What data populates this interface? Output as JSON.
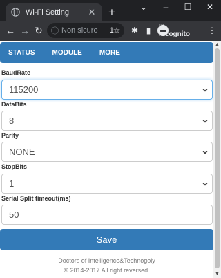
{
  "browser": {
    "tab_title": "Wi-Fi Setting",
    "tab_close": "✕",
    "new_tab": "+",
    "window_controls": [
      "⌄",
      "–",
      "☐",
      "✕"
    ],
    "back": "←",
    "forward": "→",
    "reload": "↻",
    "security_icon": "ⓘ",
    "security_label": "Non sicuro",
    "url": "1...",
    "star": "☆",
    "extensions": "✱",
    "sidepanel": "▮",
    "incognito_label": "In incognito",
    "menu": "⋮"
  },
  "nav": {
    "items": [
      "STATUS",
      "MODULE",
      "MORE"
    ]
  },
  "form": {
    "baud_label": "BaudRate",
    "baud_value": "115200",
    "databits_label": "DataBits",
    "databits_value": "8",
    "parity_label": "Parity",
    "parity_value": "NONE",
    "stopbits_label": "StopBits",
    "stopbits_value": "1",
    "timeout_label": "Serial Split timeout(ms)",
    "timeout_value": "50",
    "save_label": "Save"
  },
  "footer": {
    "line1": "Doctors of Intelligence&Technogoly",
    "line2": "© 2014-2017 All right reversed."
  },
  "scrollbar": {
    "up": "▲",
    "down": "▼"
  },
  "colors": {
    "brand": "#337ab7",
    "chrome_dark": "#202124",
    "chrome_toolbar": "#35363a"
  }
}
